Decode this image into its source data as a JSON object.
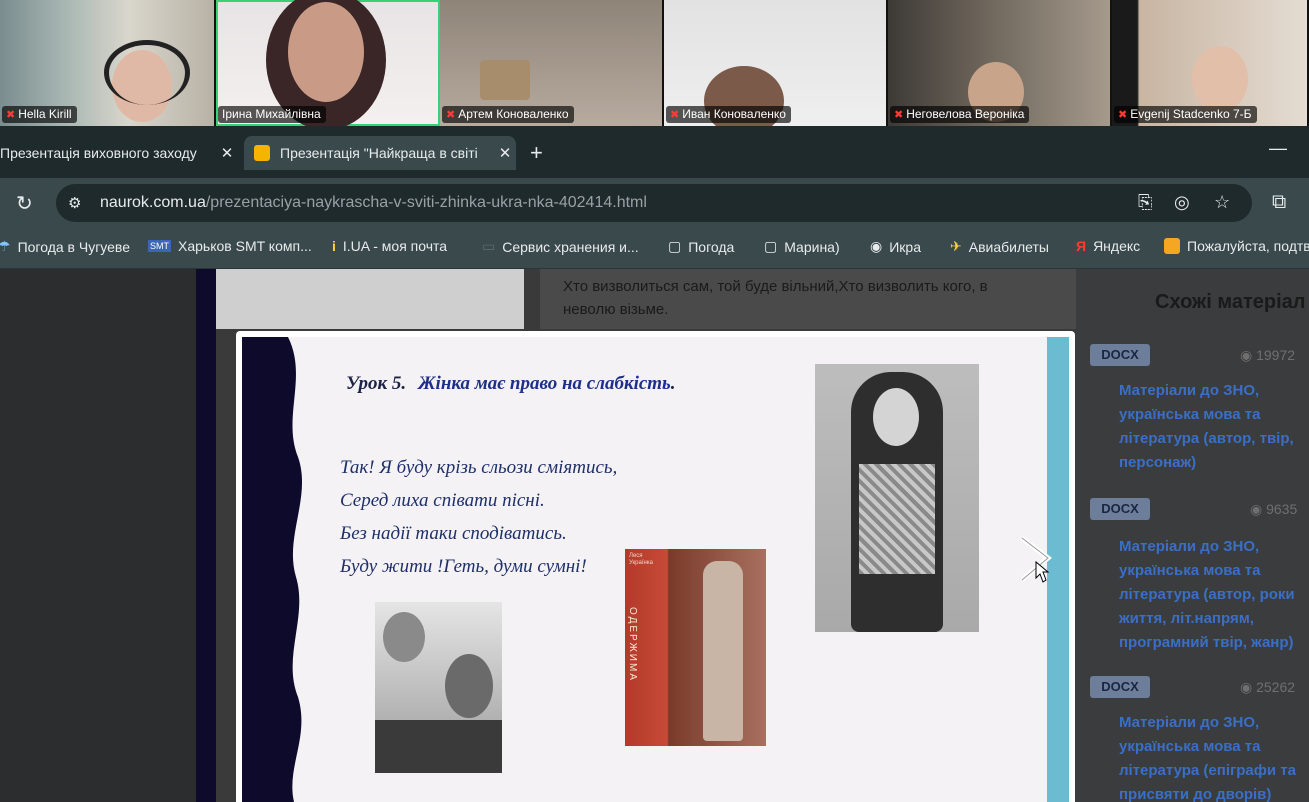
{
  "meeting": {
    "participants": [
      {
        "name": "Hella Kirill",
        "muted": true,
        "active": false
      },
      {
        "name": "Ірина Михайлівна",
        "muted": false,
        "active": true
      },
      {
        "name": "Артем Коноваленко",
        "muted": true,
        "active": false
      },
      {
        "name": "Иван Коноваленко",
        "muted": true,
        "active": false
      },
      {
        "name": "Неговелова Вероніка",
        "muted": true,
        "active": false
      },
      {
        "name": "Evgenij Stadcenko 7-Б",
        "muted": true,
        "active": false
      }
    ]
  },
  "browser": {
    "tabs": [
      {
        "title": "Презентація виховного заходу",
        "active": false
      },
      {
        "title": "Презентація \"Найкраща в світі",
        "active": true
      }
    ],
    "url": {
      "host": "naurok.com.ua",
      "path": "/prezentaciya-naykrascha-v-sviti-zhinka-ukra-nka-402414.html"
    },
    "bookmarks": [
      {
        "label": "Погода в Чугуеве",
        "icon": "weather-icon"
      },
      {
        "label": "Харьков SMT комп...",
        "icon": "smt-logo-icon"
      },
      {
        "label": "I.UA - моя почта",
        "icon": "iua-logo-icon"
      },
      {
        "label": "Сервис хранения и...",
        "icon": "storage-icon"
      },
      {
        "label": "Погода",
        "icon": "folder-icon"
      },
      {
        "label": "Марина)",
        "icon": "folder-icon"
      },
      {
        "label": "Икра",
        "icon": "globe-icon"
      },
      {
        "label": "Авиабилеты",
        "icon": "plane-icon"
      },
      {
        "label": "Яндекс",
        "icon": "yandex-icon"
      },
      {
        "label": "Пожалуйста, подтв",
        "icon": "puzzle-logo-icon"
      }
    ]
  },
  "page": {
    "quote": "Хто визволиться сам, той буде вільний,Хто визволить кого, в неволю візьме.",
    "sidebar": {
      "title": "Схожі матеріал",
      "cards": [
        {
          "badge": "DOCX",
          "views": "19972",
          "title": "Матеріали до ЗНО, українська мова та література (автор, твір, персонаж)"
        },
        {
          "badge": "DOCX",
          "views": "9635",
          "title": "Матеріали до ЗНО, українська мова та література (автор, роки життя, літ.напрям, програмний твір, жанр)"
        },
        {
          "badge": "DOCX",
          "views": "25262",
          "title": "Матеріали до ЗНО, українська мова та література (епіграфи та присвяти до дворів)"
        }
      ]
    }
  },
  "slide": {
    "lesson_number": "Урок 5.",
    "lesson_topic": "Жінка має право на слабкість",
    "lesson_suffix": ".",
    "poem": [
      "Так! Я буду крізь сльози сміятись,",
      "Серед лиха співати пісні.",
      "Без надії таки сподіватись.",
      "Буду жити !Геть, думи сумні!"
    ],
    "book_author": "Леся Українка",
    "book_title": "ОДЕРЖИМА"
  },
  "colors": {
    "accent_active": "#39d07a",
    "link": "#3a6fc7",
    "slide_wave": "#0e0a2c",
    "slide_bar": "#6bbcd0"
  }
}
